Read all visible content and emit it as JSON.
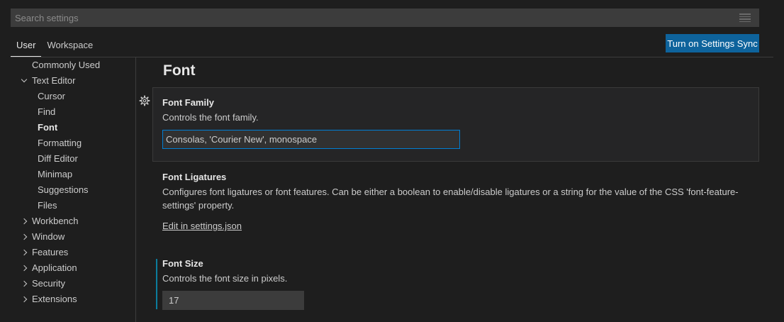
{
  "search": {
    "placeholder": "Search settings"
  },
  "tabs": [
    {
      "label": "User",
      "active": true
    },
    {
      "label": "Workspace",
      "active": false
    }
  ],
  "sync_button": {
    "label": "Turn on Settings Sync"
  },
  "toc": {
    "commonly_used": "Commonly Used",
    "text_editor": "Text Editor",
    "text_editor_children": [
      "Cursor",
      "Find",
      "Font",
      "Formatting",
      "Diff Editor",
      "Minimap",
      "Suggestions",
      "Files"
    ],
    "selected": "Font",
    "groups": [
      "Workbench",
      "Window",
      "Features",
      "Application",
      "Security",
      "Extensions"
    ]
  },
  "section": {
    "title": "Font"
  },
  "settings": {
    "font_family": {
      "title": "Font Family",
      "description": "Controls the font family.",
      "value": "Consolas, 'Courier New', monospace"
    },
    "font_ligatures": {
      "title": "Font Ligatures",
      "description_line1": "Configures font ligatures or font features. Can be either a boolean to enable/disable ligatures or a string for the value of the CSS 'font-feature-",
      "description_line2": "settings' property.",
      "link": "Edit in settings.json"
    },
    "font_size": {
      "title": "Font Size",
      "description": "Controls the font size in pixels.",
      "value": "17"
    }
  },
  "colors": {
    "background": "#1e1e1e",
    "accent_button": "#0e639c",
    "focus_border": "#007fd4",
    "modified_indicator": "#0c7d9d"
  }
}
